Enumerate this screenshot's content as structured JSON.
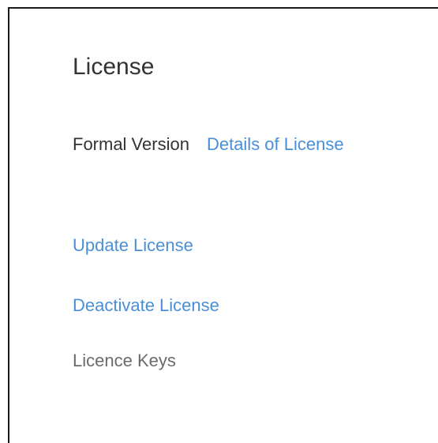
{
  "license": {
    "title": "License",
    "version_label": "Formal Version",
    "details_link": "Details of License",
    "update_link": "Update License",
    "deactivate_link": "Deactivate License",
    "keys_link": "Licence Keys"
  },
  "colors": {
    "link": "#4a8fd6",
    "text": "#333333",
    "muted": "#6b6b6b"
  }
}
